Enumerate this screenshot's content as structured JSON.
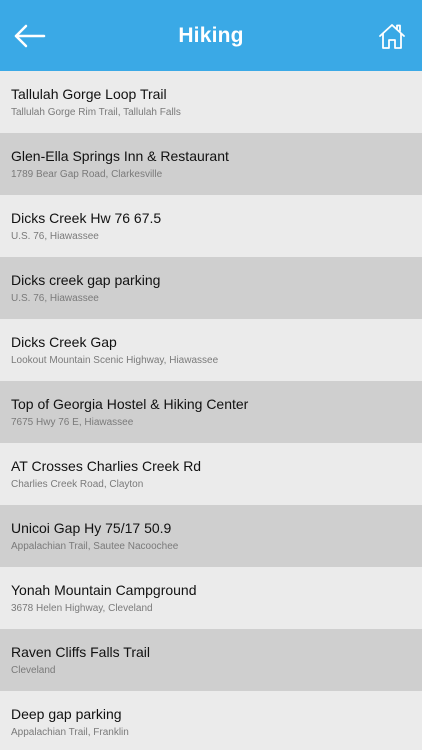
{
  "header": {
    "title": "Hiking",
    "back_icon": "arrow-left-icon",
    "home_icon": "home-icon",
    "background": "#3aa9e6"
  },
  "items": [
    {
      "name": "Tallulah Gorge Loop Trail",
      "address": "Tallulah Gorge Rim Trail, Tallulah Falls"
    },
    {
      "name": "Glen-Ella Springs Inn & Restaurant",
      "address": "1789 Bear Gap Road, Clarkesville"
    },
    {
      "name": "Dicks Creek Hw 76 67.5",
      "address": "U.S. 76, Hiawassee"
    },
    {
      "name": "Dicks creek gap parking",
      "address": "U.S. 76, Hiawassee"
    },
    {
      "name": "Dicks Creek Gap",
      "address": "Lookout Mountain Scenic Highway, Hiawassee"
    },
    {
      "name": "Top of Georgia Hostel & Hiking Center",
      "address": "7675 Hwy 76 E, Hiawassee"
    },
    {
      "name": "AT Crosses Charlies Creek Rd",
      "address": "Charlies Creek Road, Clayton"
    },
    {
      "name": "Unicoi Gap Hy 75/17 50.9",
      "address": "Appalachian Trail, Sautee Nacoochee"
    },
    {
      "name": "Yonah Mountain Campground",
      "address": "3678 Helen Highway, Cleveland"
    },
    {
      "name": "Raven Cliffs Falls Trail",
      "address": "Cleveland"
    },
    {
      "name": "Deep gap parking",
      "address": "Appalachian Trail, Franklin"
    }
  ]
}
